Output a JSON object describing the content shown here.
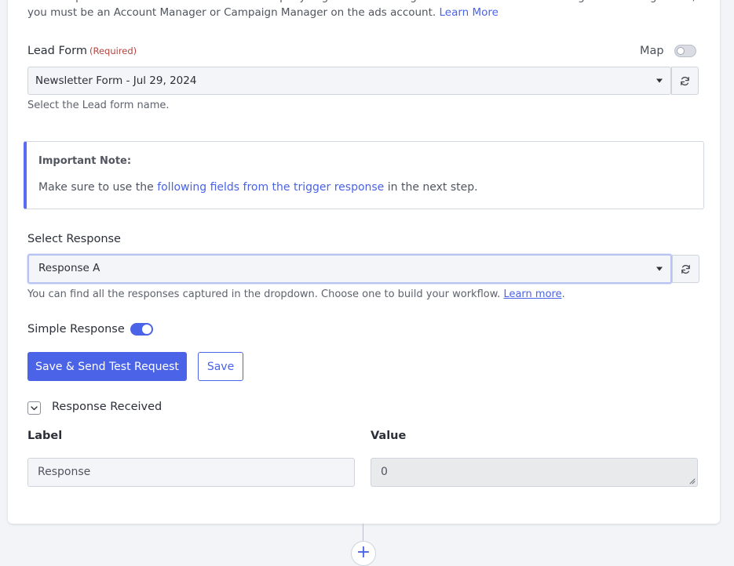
{
  "intro": {
    "text": "Choose sponsored account. You must be a Company Page Admin or assigned as a Lead Gen Form Manager for the Page. Also, you must be an Account Manager or Campaign Manager on the ads account.",
    "link": "Learn More"
  },
  "lead_form": {
    "label": "Lead Form",
    "required": "(Required)",
    "map_label": "Map",
    "map_enabled": false,
    "selected": "Newsletter Form - Jul 29, 2024",
    "help": "Select the Lead form name."
  },
  "note": {
    "title": "Important Note:",
    "body_pre": "Make sure to use the",
    "body_link": "following fields from the trigger response",
    "body_post": "in the next step."
  },
  "response": {
    "label": "Select Response",
    "selected": "Response A",
    "help": "You can find all the responses captured in the dropdown. Choose one to build your workflow.",
    "help_link": "Learn more",
    "help_end": "."
  },
  "simple_response": {
    "label": "Simple Response",
    "enabled": true
  },
  "actions": {
    "save_test": "Save & Send Test Request",
    "save": "Save"
  },
  "received": {
    "title": "Response Received",
    "col_label": "Label",
    "col_value": "Value",
    "rows": [
      {
        "label": "Response",
        "value": "0"
      }
    ]
  },
  "colors": {
    "accent": "#4a63e7",
    "required": "#b3443f"
  },
  "icons": [
    "refresh-icon",
    "caret-down-icon",
    "chevron-down-icon",
    "plus-icon",
    "resize-handle-icon"
  ]
}
